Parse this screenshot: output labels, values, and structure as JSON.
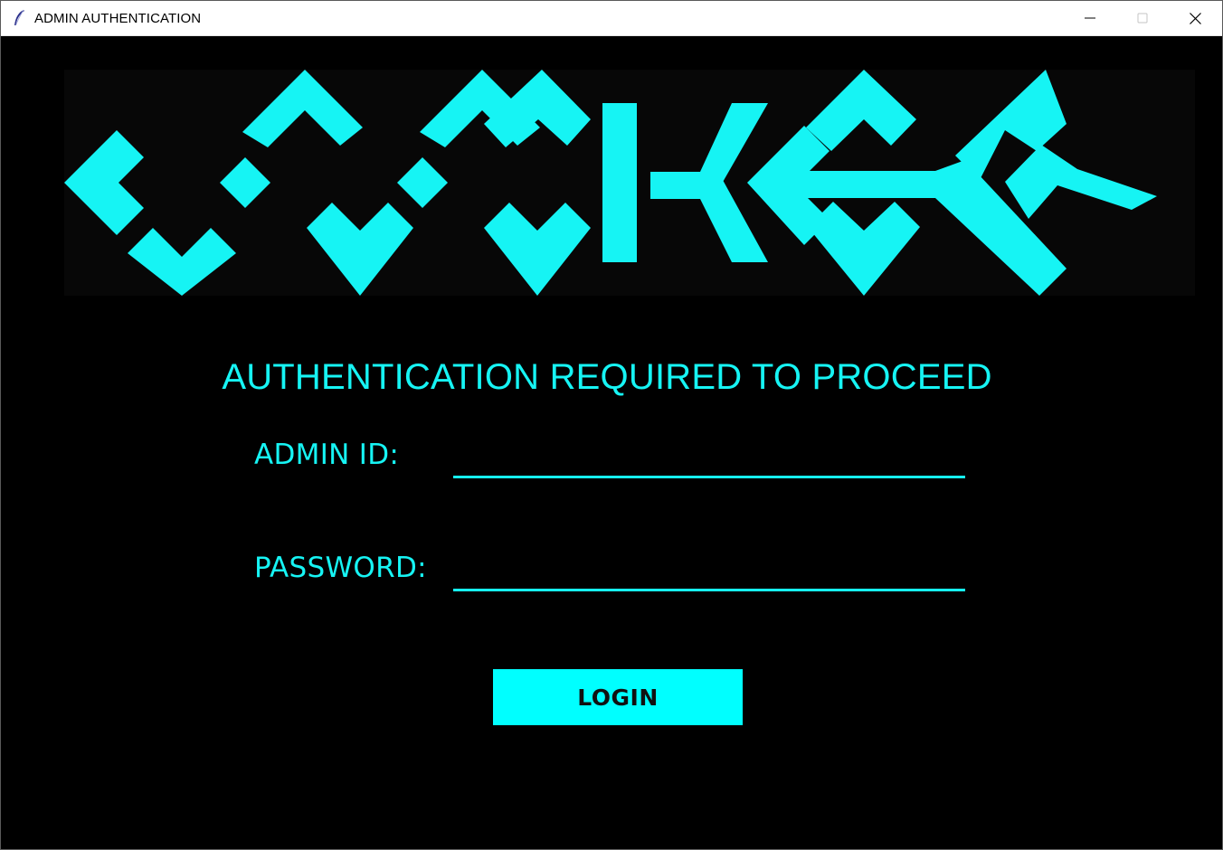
{
  "window": {
    "title": "ADMIN AUTHENTICATION",
    "controls": [
      "minimize-icon",
      "maximize-icon",
      "close-icon"
    ]
  },
  "logo": {
    "text": "LOCKER",
    "color": "#16f4f4"
  },
  "heading": "AUTHENTICATION REQUIRED TO PROCEED",
  "form": {
    "admin_id": {
      "label": "ADMIN ID:",
      "value": ""
    },
    "password": {
      "label": "PASSWORD:",
      "value": ""
    },
    "login_label": "LOGIN"
  },
  "colors": {
    "accent": "#16f4f4",
    "button": "#00ffff",
    "background": "#000000",
    "titlebar": "#ffffff"
  }
}
